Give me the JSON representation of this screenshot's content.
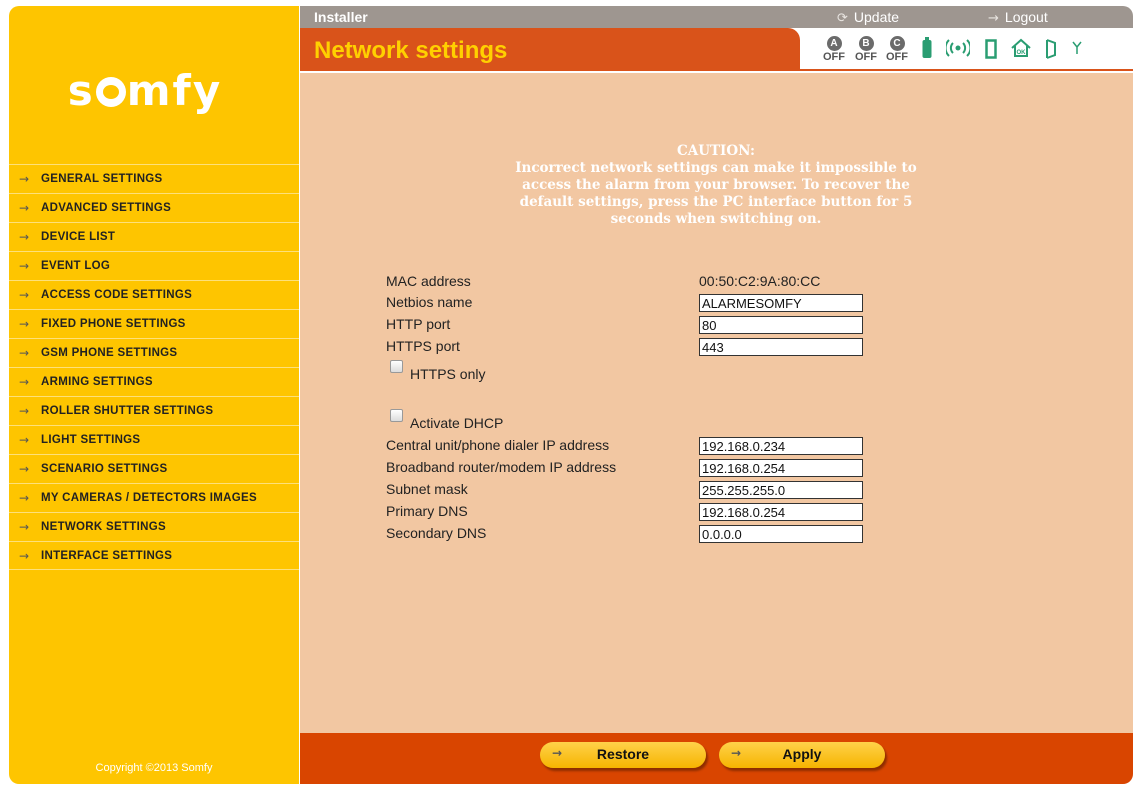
{
  "brand": {
    "logo_text": "somfy"
  },
  "sidebar": {
    "items": [
      {
        "label": "GENERAL SETTINGS"
      },
      {
        "label": "ADVANCED SETTINGS"
      },
      {
        "label": "DEVICE LIST"
      },
      {
        "label": "EVENT LOG"
      },
      {
        "label": "ACCESS CODE SETTINGS"
      },
      {
        "label": "FIXED PHONE SETTINGS"
      },
      {
        "label": "GSM PHONE SETTINGS"
      },
      {
        "label": "ARMING SETTINGS"
      },
      {
        "label": "ROLLER SHUTTER SETTINGS"
      },
      {
        "label": "LIGHT SETTINGS"
      },
      {
        "label": "SCENARIO SETTINGS"
      },
      {
        "label": "MY CAMERAS / DETECTORS IMAGES"
      },
      {
        "label": "NETWORK SETTINGS"
      },
      {
        "label": "INTERFACE SETTINGS"
      }
    ],
    "copyright": "Copyright ©2013 Somfy"
  },
  "topbar": {
    "role": "Installer",
    "update_label": "Update",
    "logout_label": "Logout"
  },
  "page_title": "Network settings",
  "status": {
    "zones": [
      {
        "letter": "A",
        "state": "OFF"
      },
      {
        "letter": "B",
        "state": "OFF"
      },
      {
        "letter": "C",
        "state": "OFF"
      }
    ],
    "icons": [
      "battery-icon",
      "wireless-signal-icon",
      "door-sensor-icon",
      "home-ok-icon",
      "door-open-icon",
      "antenna-icon"
    ]
  },
  "caution": {
    "title": "CAUTION:",
    "lines": [
      "Incorrect network settings can make it impossible to",
      "access the alarm from your browser. To recover the",
      "default settings, press the PC interface button for 5",
      "seconds when switching on."
    ]
  },
  "form": {
    "mac_label": "MAC address",
    "mac_value": "00:50:C2:9A:80:CC",
    "netbios_label": "Netbios name",
    "netbios_value": "ALARMESOMFY",
    "http_label": "HTTP port",
    "http_value": "80",
    "https_label": "HTTPS port",
    "https_value": "443",
    "https_only_label": "HTTPS only",
    "dhcp_label": "Activate DHCP",
    "central_ip_label": "Central unit/phone dialer IP address",
    "central_ip_value": "192.168.0.234",
    "router_ip_label": "Broadband router/modem IP address",
    "router_ip_value": "192.168.0.254",
    "subnet_label": "Subnet mask",
    "subnet_value": "255.255.255.0",
    "dns1_label": "Primary DNS",
    "dns1_value": "192.168.0.254",
    "dns2_label": "Secondary DNS",
    "dns2_value": "0.0.0.0"
  },
  "footer": {
    "restore_label": "Restore",
    "apply_label": "Apply"
  },
  "colors": {
    "sidebar": "#fec500",
    "accent": "#d9531a",
    "content_bg": "#f2c7a2",
    "title_text": "#ffd000",
    "status_icon": "#2a9d72"
  }
}
